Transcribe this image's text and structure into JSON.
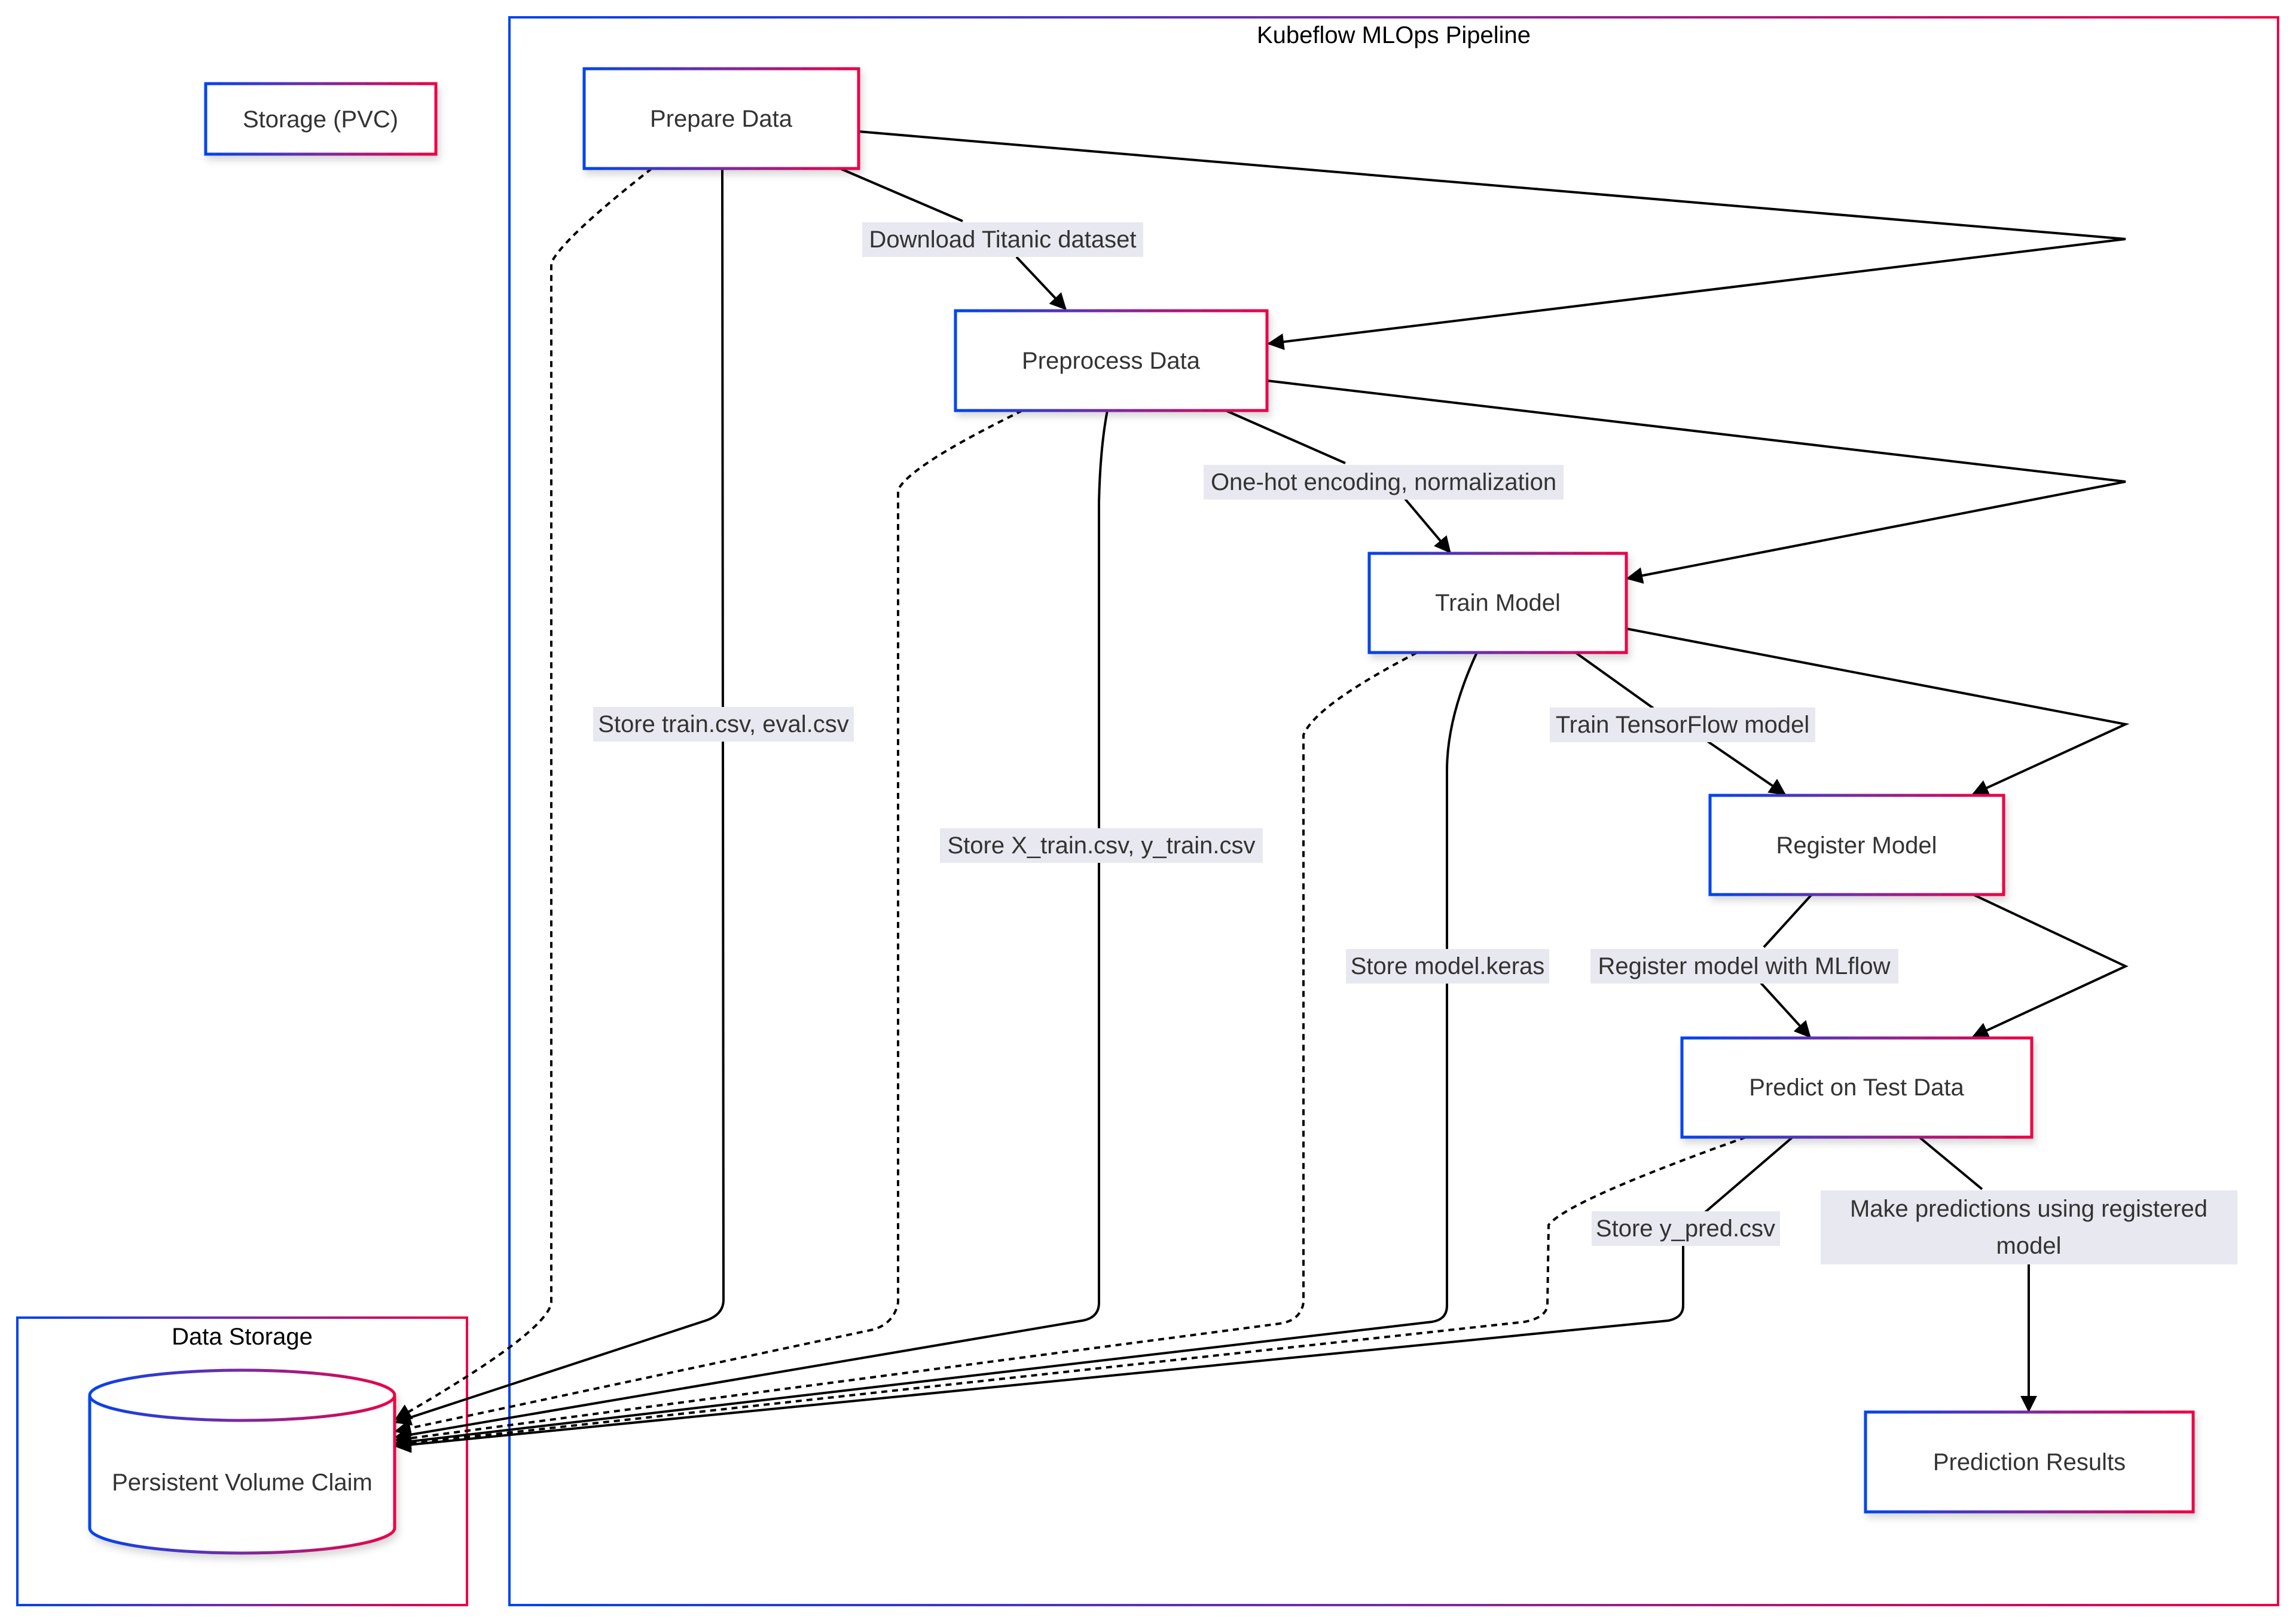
{
  "diagram": {
    "colors": {
      "border_gradient_start": "#0044ee",
      "border_gradient_mid": "#7a2aa0",
      "border_gradient_end": "#ee0044",
      "edge": "#000000",
      "label_background": "#e8e8f0",
      "text": "#333333"
    },
    "legend_node": {
      "label": "Storage (PVC)"
    },
    "clusters": {
      "pipeline": {
        "title": "Kubeflow MLOps Pipeline"
      },
      "storage": {
        "title": "Data Storage"
      }
    },
    "nodes": {
      "prepare": {
        "label": "Prepare Data"
      },
      "preprocess": {
        "label": "Preprocess Data"
      },
      "train": {
        "label": "Train Model"
      },
      "register": {
        "label": "Register Model"
      },
      "predict": {
        "label": "Predict on Test Data"
      },
      "results": {
        "label": "Prediction Results"
      },
      "pvc": {
        "label": "Persistent Volume Claim",
        "shape": "cylinder"
      }
    },
    "edges": [
      {
        "from": "Prepare Data",
        "to": "Preprocess Data",
        "label": "Download Titanic dataset",
        "style": "solid"
      },
      {
        "from": "Prepare Data",
        "to": "Preprocess Data",
        "label": "",
        "style": "solid"
      },
      {
        "from": "Prepare Data",
        "to": "Persistent Volume Claim",
        "label": "Store train.csv, eval.csv",
        "style": "solid"
      },
      {
        "from": "Prepare Data",
        "to": "Persistent Volume Claim",
        "label": "",
        "style": "dashed"
      },
      {
        "from": "Preprocess Data",
        "to": "Train Model",
        "label": "One-hot encoding, normalization",
        "style": "solid"
      },
      {
        "from": "Preprocess Data",
        "to": "Train Model",
        "label": "",
        "style": "solid"
      },
      {
        "from": "Preprocess Data",
        "to": "Persistent Volume Claim",
        "label": "Store X_train.csv, y_train.csv",
        "style": "solid"
      },
      {
        "from": "Preprocess Data",
        "to": "Persistent Volume Claim",
        "label": "",
        "style": "dashed"
      },
      {
        "from": "Train Model",
        "to": "Register Model",
        "label": "Train TensorFlow model",
        "style": "solid"
      },
      {
        "from": "Train Model",
        "to": "Register Model",
        "label": "",
        "style": "solid"
      },
      {
        "from": "Train Model",
        "to": "Persistent Volume Claim",
        "label": "Store model.keras",
        "style": "solid"
      },
      {
        "from": "Train Model",
        "to": "Persistent Volume Claim",
        "label": "",
        "style": "dashed"
      },
      {
        "from": "Register Model",
        "to": "Predict on Test Data",
        "label": "Register model with MLflow",
        "style": "solid"
      },
      {
        "from": "Register Model",
        "to": "Predict on Test Data",
        "label": "",
        "style": "solid"
      },
      {
        "from": "Predict on Test Data",
        "to": "Persistent Volume Claim",
        "label": "Store y_pred.csv",
        "style": "solid"
      },
      {
        "from": "Predict on Test Data",
        "to": "Persistent Volume Claim",
        "label": "",
        "style": "dashed"
      },
      {
        "from": "Predict on Test Data",
        "to": "Prediction Results",
        "label": "Make predictions using registered model",
        "style": "solid"
      }
    ],
    "edge_labels": {
      "download": "Download Titanic dataset",
      "onehot": "One-hot encoding, normalization",
      "train_tf": "Train TensorFlow model",
      "register_mlflow": "Register model with MLflow",
      "make_pred_line1": "Make predictions using registered",
      "make_pred_line2": "model",
      "store_train": "Store train.csv, eval.csv",
      "store_xtrain": "Store X_train.csv, y_train.csv",
      "store_model": "Store model.keras",
      "store_ypred": "Store y_pred.csv"
    }
  }
}
